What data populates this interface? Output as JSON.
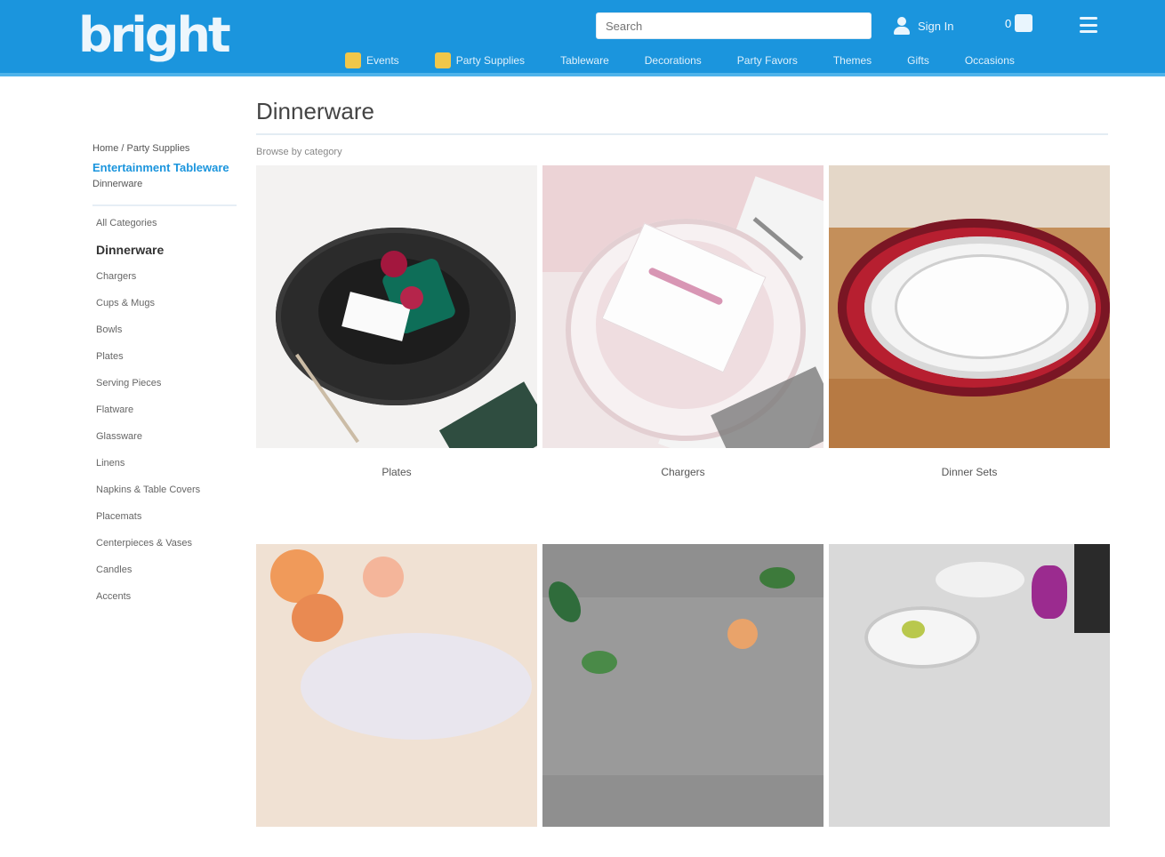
{
  "header": {
    "logo_text": "bright",
    "search_placeholder": "Search",
    "signin_label": "Sign In",
    "cart_count": "0",
    "nav": [
      {
        "label": "Events",
        "icon": "calendar-icon"
      },
      {
        "label": "Party Supplies",
        "icon": "balloon-icon"
      },
      {
        "label": "Tableware"
      },
      {
        "label": "Decorations"
      },
      {
        "label": "Party Favors"
      },
      {
        "label": "Themes"
      },
      {
        "label": "Gifts"
      },
      {
        "label": "Occasions"
      }
    ]
  },
  "sidebar": {
    "crumb_top": "Home / Party Supplies",
    "crumb_link": "Entertainment Tableware",
    "crumb_sub": "Dinnerware",
    "categories": [
      {
        "label": "All Categories",
        "active": false
      },
      {
        "label": "Dinnerware",
        "active": true
      },
      {
        "label": "Chargers",
        "active": false
      },
      {
        "label": "Cups & Mugs",
        "active": false
      },
      {
        "label": "Bowls",
        "active": false
      },
      {
        "label": "Plates",
        "active": false
      },
      {
        "label": "Serving Pieces",
        "active": false
      },
      {
        "label": "Flatware",
        "active": false
      },
      {
        "label": "Glassware",
        "active": false
      },
      {
        "label": "Linens",
        "active": false
      },
      {
        "label": "Napkins & Table Covers",
        "active": false
      },
      {
        "label": "Placemats",
        "active": false
      },
      {
        "label": "Centerpieces & Vases",
        "active": false
      },
      {
        "label": "Candles",
        "active": false
      },
      {
        "label": "Accents",
        "active": false
      }
    ]
  },
  "main": {
    "title": "Dinnerware",
    "results": "Browse by category"
  },
  "tiles": [
    {
      "label": "Plates"
    },
    {
      "label": "Chargers"
    },
    {
      "label": "Dinner Sets"
    },
    {
      "label": ""
    },
    {
      "label": ""
    },
    {
      "label": ""
    }
  ],
  "colors": {
    "header_bg": "#1b95dd",
    "accent": "#1b95dd"
  }
}
